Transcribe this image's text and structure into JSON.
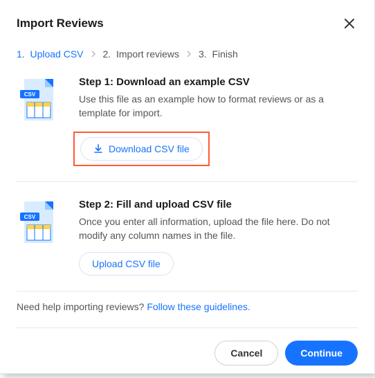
{
  "header": {
    "title": "Import Reviews"
  },
  "breadcrumb": {
    "items": [
      {
        "num": "1.",
        "label": "Upload CSV"
      },
      {
        "num": "2.",
        "label": "Import reviews"
      },
      {
        "num": "3.",
        "label": "Finish"
      }
    ]
  },
  "steps": {
    "one": {
      "title": "Step 1: Download an example CSV",
      "desc": "Use this file as an example how to format reviews or as a template for import.",
      "button": "Download CSV file"
    },
    "two": {
      "title": "Step 2: Fill and upload CSV file",
      "desc": "Once you enter all information, upload the file here. Do not modify any column names in the file.",
      "button": "Upload CSV file"
    }
  },
  "help": {
    "text": "Need help importing reviews? ",
    "link": "Follow these guidelines."
  },
  "footer": {
    "cancel": "Cancel",
    "continue": "Continue"
  }
}
